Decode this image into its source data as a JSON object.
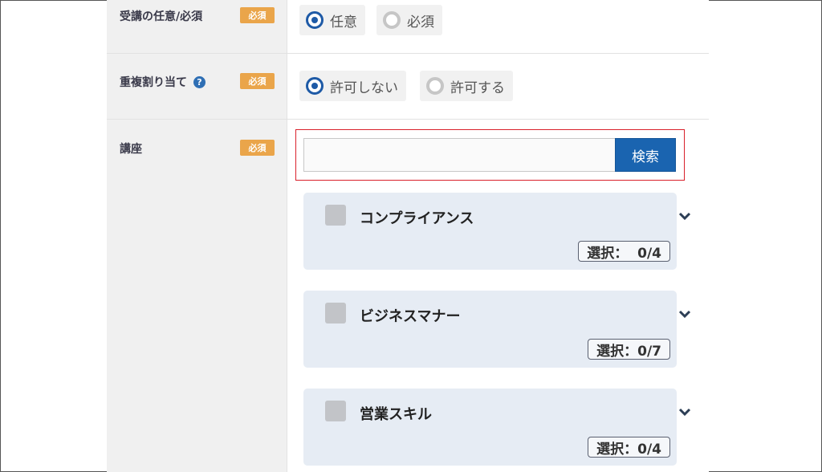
{
  "rows": [
    {
      "label": "受講の任意/必須",
      "badge": "必須",
      "options": [
        {
          "label": "任意",
          "checked": true
        },
        {
          "label": "必須",
          "checked": false
        }
      ]
    },
    {
      "label": "重複割り当て",
      "help_icon": "?",
      "badge": "必須",
      "options": [
        {
          "label": "許可しない",
          "checked": true
        },
        {
          "label": "許可する",
          "checked": false
        }
      ]
    },
    {
      "label": "講座",
      "badge": "必須"
    }
  ],
  "search": {
    "value": "",
    "placeholder": "",
    "button_label": "検索"
  },
  "courses": [
    {
      "title": "コンプライアンス",
      "selected_text": "選択：  0/4",
      "checked": false
    },
    {
      "title": "ビジネスマナー",
      "selected_text": "選択：0/7",
      "checked": false
    },
    {
      "title": "営業スキル",
      "selected_text": "選択：0/4",
      "checked": false
    }
  ],
  "icons": {
    "help": "question-circle-icon",
    "expand": "chevron-down-icon"
  },
  "colors": {
    "accent": "#1a64b0",
    "required_badge": "#eaa54a",
    "highlight_outline": "#d9202b",
    "card_bg": "#e6ecf4"
  }
}
